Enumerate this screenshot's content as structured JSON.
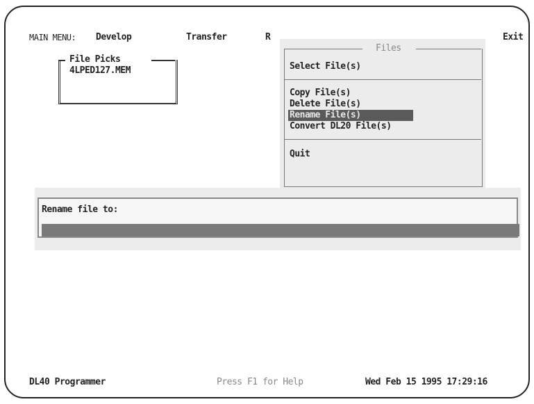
{
  "menu_bar": {
    "label": "MAIN MENU:",
    "items": [
      "Develop",
      "Transfer",
      "R",
      "Exit"
    ]
  },
  "file_picks": {
    "title": "File Picks",
    "file": "4LPED127.MEM"
  },
  "files_menu": {
    "title": "Files",
    "items": {
      "select": "Select File(s)",
      "copy": "Copy File(s)",
      "delete": "Delete File(s)",
      "rename": "Rename File(s)",
      "convert": "Convert DL20 File(s)",
      "quit": "Quit"
    },
    "selected": "Rename File(s)"
  },
  "rename_dialog": {
    "prompt": "Rename file to:",
    "value": ""
  },
  "status_bar": {
    "app": "DL40 Programmer",
    "help": "Press F1 for Help",
    "datetime": "Wed Feb 15 1995 17:29:16"
  }
}
